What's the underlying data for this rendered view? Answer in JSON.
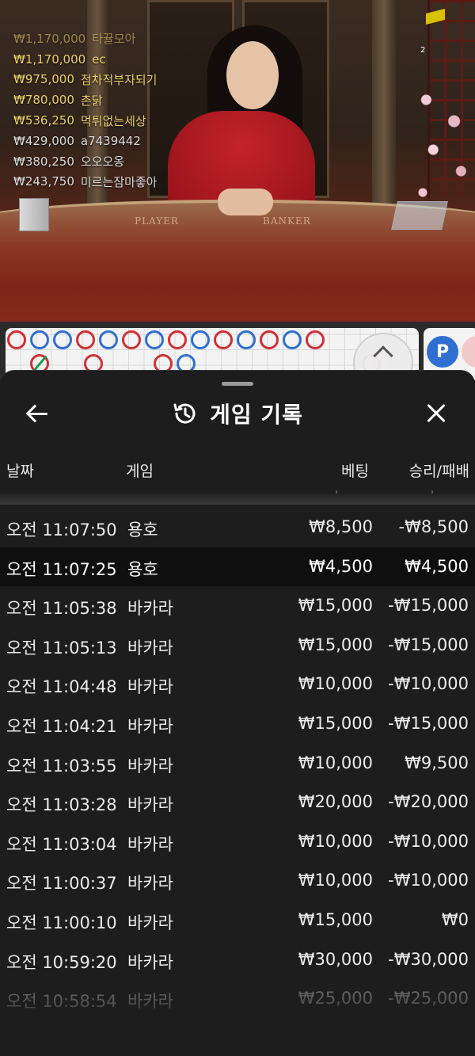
{
  "video": {
    "viewer_count": "2",
    "table_labels": {
      "player": "PLAYER",
      "banker": "BANKER"
    },
    "leaderboard": [
      {
        "amount": "₩1,170,000",
        "name": "타뀰모아",
        "tone": "gold",
        "faded": true
      },
      {
        "amount": "₩1,170,000",
        "name": "ec",
        "tone": "gold",
        "faded": false
      },
      {
        "amount": "₩975,000",
        "name": "점차적부자되기",
        "tone": "gold",
        "faded": false
      },
      {
        "amount": "₩780,000",
        "name": "촌닭",
        "tone": "gold",
        "faded": false
      },
      {
        "amount": "₩536,250",
        "name": "먹튀없는세상",
        "tone": "gold",
        "faded": false
      },
      {
        "amount": "₩429,000",
        "name": "a7439442",
        "tone": "gray",
        "faded": false
      },
      {
        "amount": "₩380,250",
        "name": "오오오옹",
        "tone": "gray",
        "faded": false
      },
      {
        "amount": "₩243,750",
        "name": "미르는잠마좋아",
        "tone": "gray",
        "faded": false
      }
    ],
    "colors": {
      "gold": "#ecd26a",
      "gray": "#dcdcdc"
    }
  },
  "roadmap": {
    "top_row": [
      "B",
      "P",
      "P",
      "B",
      "P",
      "B",
      "P",
      "B",
      "P",
      "B",
      "P",
      "B",
      "P",
      "B"
    ],
    "second_row": {
      "slash_col": 1,
      "beads": [
        {
          "col": 4,
          "r": "B"
        },
        {
          "col": 7,
          "r": "B"
        },
        {
          "col": 8,
          "r": "P"
        },
        {
          "col": 16,
          "r": "B"
        }
      ]
    },
    "side_badge": "P",
    "colors": {
      "player": "#2f6fd1",
      "banker": "#d12f36"
    },
    "scroll_icon": "chevron-up-icon"
  },
  "sheet": {
    "title": "게임 기록",
    "icons": {
      "back": "arrow-left-icon",
      "history": "history-icon",
      "close": "close-icon"
    },
    "columns": {
      "date": "날짜",
      "game": "게임",
      "bet": "베팅",
      "result": "승리/패배"
    },
    "rows": [
      {
        "time": "오전 11:07:50",
        "game": "용호",
        "bet": "₩8,500",
        "result": "-₩8,500",
        "active": false
      },
      {
        "time": "오전 11:07:25",
        "game": "용호",
        "bet": "₩4,500",
        "result": "₩4,500",
        "active": true
      },
      {
        "time": "오전 11:05:38",
        "game": "바카라",
        "bet": "₩15,000",
        "result": "-₩15,000",
        "active": false
      },
      {
        "time": "오전 11:05:13",
        "game": "바카라",
        "bet": "₩15,000",
        "result": "-₩15,000",
        "active": false
      },
      {
        "time": "오전 11:04:48",
        "game": "바카라",
        "bet": "₩10,000",
        "result": "-₩10,000",
        "active": false
      },
      {
        "time": "오전 11:04:21",
        "game": "바카라",
        "bet": "₩15,000",
        "result": "-₩15,000",
        "active": false
      },
      {
        "time": "오전 11:03:55",
        "game": "바카라",
        "bet": "₩10,000",
        "result": "₩9,500",
        "active": false
      },
      {
        "time": "오전 11:03:28",
        "game": "바카라",
        "bet": "₩20,000",
        "result": "-₩20,000",
        "active": false
      },
      {
        "time": "오전 11:03:04",
        "game": "바카라",
        "bet": "₩10,000",
        "result": "-₩10,000",
        "active": false
      },
      {
        "time": "오전 11:00:37",
        "game": "바카라",
        "bet": "₩10,000",
        "result": "-₩10,000",
        "active": false
      },
      {
        "time": "오전 11:00:10",
        "game": "바카라",
        "bet": "₩15,000",
        "result": "₩0",
        "active": false
      },
      {
        "time": "오전 10:59:20",
        "game": "바카라",
        "bet": "₩30,000",
        "result": "-₩30,000",
        "active": false
      },
      {
        "time": "오전 10:58:54",
        "game": "바카라",
        "bet": "₩25,000",
        "result": "-₩25,000",
        "active": false,
        "fade": true
      }
    ]
  }
}
